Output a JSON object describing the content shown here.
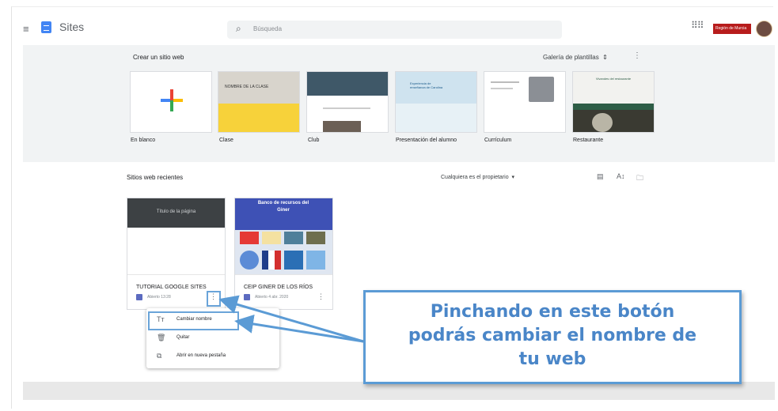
{
  "header": {
    "brand": "Sites",
    "search_placeholder": "Búsqueda",
    "badge_text": "Región de Murcia"
  },
  "gallery": {
    "title": "Crear un sitio web",
    "gallery_link": "Galería de plantillas",
    "templates": [
      {
        "label": "En blanco"
      },
      {
        "label": "Clase",
        "thumb_text": "NOMBRE DE LA CLASE"
      },
      {
        "label": "Club"
      },
      {
        "label": "Presentación del alumno",
        "thumb_text": "Experiencia de enseñanza de Carolina"
      },
      {
        "label": "Currículum"
      },
      {
        "label": "Restaurante",
        "thumb_text": "Vivandes del restaurante"
      }
    ]
  },
  "recent": {
    "title": "Sitios web recientes",
    "owner_filter": "Cualquiera es el propietario",
    "sites": [
      {
        "name": "TUTORIAL GOOGLE SITES",
        "opened": "Abierto 13:28",
        "thumb_text": "Título de la página"
      },
      {
        "name": "CEIP GINER DE LOS RÍOS",
        "opened": "Abierto 4 abr. 2020",
        "thumb_text": "Banco de recursos del Giner"
      }
    ]
  },
  "context_menu": {
    "items": [
      {
        "icon": "text-format-icon",
        "glyph": "Tт",
        "label": "Cambiar nombre"
      },
      {
        "icon": "trash-icon",
        "glyph": "🗑",
        "label": "Quitar"
      },
      {
        "icon": "open-new-tab-icon",
        "glyph": "⧉",
        "label": "Abrir en nueva pestaña"
      }
    ]
  },
  "callout": {
    "line1": "Pinchando en este botón",
    "line2": "podrás cambiar el nombre de",
    "line3": "tu web"
  },
  "colors": {
    "accent": "#4285f4",
    "callout_text": "#4a86c8",
    "callout_border": "#5b9bd5",
    "gallery_bg": "#f1f3f4"
  }
}
